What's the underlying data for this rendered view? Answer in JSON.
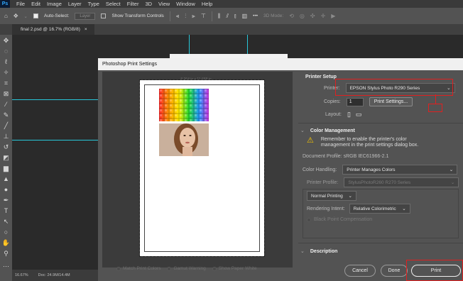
{
  "menubar": {
    "logo": "Ps",
    "items": [
      "File",
      "Edit",
      "Image",
      "Layer",
      "Type",
      "Select",
      "Filter",
      "3D",
      "View",
      "Window",
      "Help"
    ]
  },
  "options_bar": {
    "auto_select_label": "Auto-Select:",
    "auto_select_value": "Layer",
    "transform_label": "Show Transform Controls",
    "mode_label": "3D Mode:",
    "more": "•••"
  },
  "doc_tab": {
    "title": "final 2.psd @ 16.7% (RGB/8)",
    "close": "×"
  },
  "status": {
    "zoom": "16.67%",
    "doc": "Doc: 24.9M/14.4M"
  },
  "dialog": {
    "title": "Photoshop Print Settings",
    "size_label": "8.264 in x 11.688 in",
    "printer_setup": {
      "heading": "Printer Setup",
      "printer_label": "Printer:",
      "printer_value": "EPSON Stylus Photo R290 Series",
      "copies_label": "Copies:",
      "copies_value": "1",
      "print_settings_button": "Print Settings...",
      "layout_label": "Layout:"
    },
    "color_management": {
      "heading": "Color Management",
      "warning_text": "Remember to enable the printer's color management in the print settings dialog box.",
      "doc_profile": "Document Profile: sRGB IEC61966-2.1",
      "color_handling_label": "Color Handling:",
      "color_handling_value": "Printer Manages Colors",
      "printer_profile_label": "Printer Profile:",
      "printer_profile_value": "StylusPhotoR260 R270 Series",
      "normal_printing": "Normal Printing",
      "rendering_intent_label": "Rendering Intent:",
      "rendering_intent_value": "Relative Colorimetric",
      "black_point_label": "Black Point Compensation"
    },
    "description": {
      "heading": "Description"
    },
    "bottom_options": [
      "Match Print Colors",
      "Gamut Warning",
      "Show Paper White"
    ],
    "cancel_button": "Cancel",
    "done_button": "Done",
    "print_button": "Print"
  },
  "colors": {
    "highlight": "#e02020",
    "guide": "#28c7d9"
  }
}
